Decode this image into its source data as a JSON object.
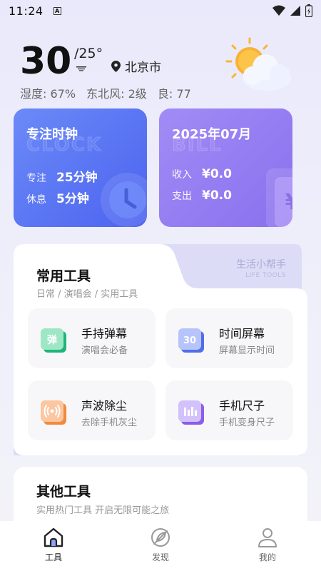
{
  "status_bar": {
    "time": "11:24",
    "notification_letter": "A"
  },
  "weather": {
    "temperature": "30",
    "high": "/25°",
    "location": "北京市",
    "humidity": "湿度: 67%",
    "wind": "东北风: 2级",
    "air_quality": "良: 77"
  },
  "focus_card": {
    "title": "专注时钟",
    "watermark": "CLOCK",
    "focus_label": "专注",
    "focus_value": "25分钟",
    "rest_label": "休息",
    "rest_value": "5分钟"
  },
  "bill_card": {
    "title": "2025年07月",
    "watermark": "BILL",
    "income_label": "收入",
    "income_value": "¥0.0",
    "expense_label": "支出",
    "expense_value": "¥0.0",
    "yen_symbol": "¥"
  },
  "tools": {
    "title": "常用工具",
    "subtitle": "日常 / 演唱会 / 实用工具",
    "helper_cn": "生活小帮手",
    "helper_en": "LIFE TOOLS",
    "items": [
      {
        "name": "手持弹幕",
        "desc": "演唱会必备",
        "icon_text": "弹",
        "color": "#2fc98a"
      },
      {
        "name": "时间屏幕",
        "desc": "屏幕显示时间",
        "icon_text": "30",
        "color": "#5a78ee"
      },
      {
        "name": "声波除尘",
        "desc": "去除手机灰尘",
        "icon_text": "",
        "color": "#f7914a"
      },
      {
        "name": "手机尺子",
        "desc": "手机变身尺子",
        "icon_text": "",
        "color": "#9a6ef0"
      }
    ]
  },
  "other_tools": {
    "title": "其他工具",
    "subtitle": "实用热门工具 开启无限可能之旅"
  },
  "bottom_nav": [
    {
      "label": "工具",
      "active": true
    },
    {
      "label": "发现",
      "active": false
    },
    {
      "label": "我的",
      "active": false
    }
  ]
}
